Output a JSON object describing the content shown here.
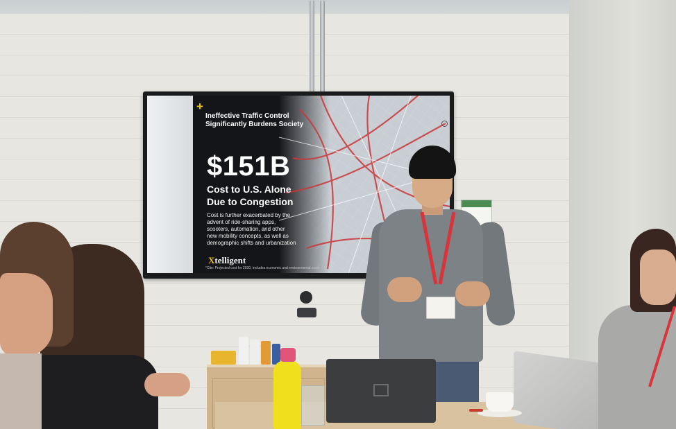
{
  "slide": {
    "title_line1": "Ineffective Traffic Control",
    "title_line2": "Significantly Burdens Society",
    "big_number": "$151B",
    "subtitle_line1": "Cost to U.S. Alone",
    "subtitle_line2": "Due to Congestion",
    "body_lines": [
      "Cost is further exacerbated by the",
      "advent of ride-sharing apps,",
      "scooters, automation, and other",
      "new mobility concepts, as well as",
      "demographic shifts and urbanization"
    ],
    "brand_x": "X",
    "brand_rest": "telligent",
    "footnote": "*Cite: Projected cost for 2030, includes economic and environmental costs",
    "accent_color": "#f2c200"
  },
  "colors": {
    "lanyard": "#d8343a",
    "traffic_red": "#c8383a"
  }
}
